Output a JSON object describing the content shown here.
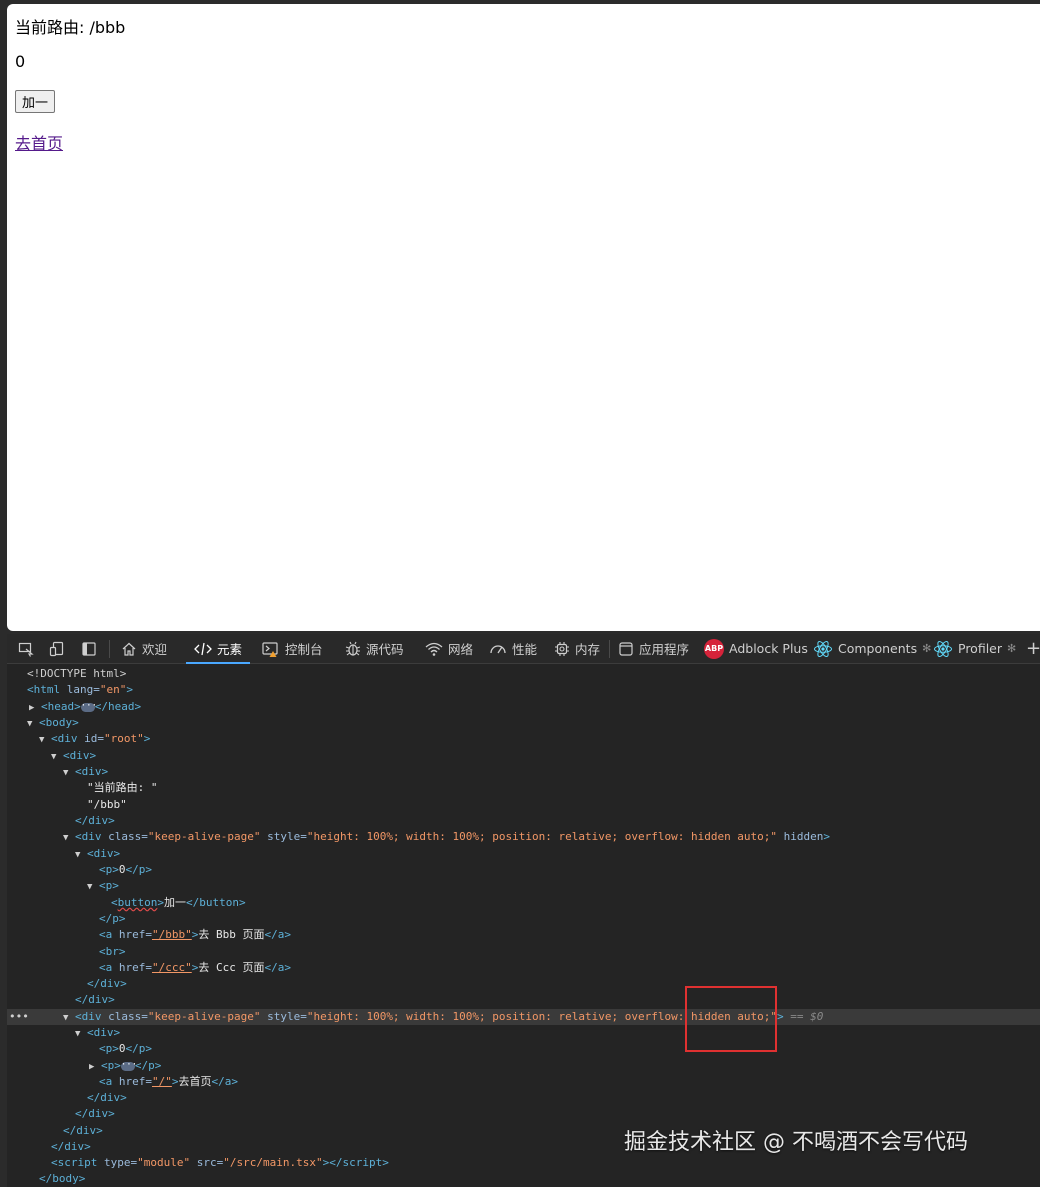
{
  "page": {
    "route_label": "当前路由: /bbb",
    "count": "0",
    "increment_button": "加一",
    "home_link": "去首页"
  },
  "devtools": {
    "tabs": [
      {
        "label": "欢迎",
        "icon": "home-icon"
      },
      {
        "label": "元素",
        "icon": "code-icon",
        "active": true
      },
      {
        "label": "控制台",
        "icon": "console-warning-icon"
      },
      {
        "label": "源代码",
        "icon": "bug-icon"
      },
      {
        "label": "网络",
        "icon": "wifi-icon"
      },
      {
        "label": "性能",
        "icon": "gauge-icon"
      },
      {
        "label": "内存",
        "icon": "chip-icon"
      },
      {
        "label": "应用程序",
        "icon": "app-icon"
      },
      {
        "label": "Adblock Plus",
        "icon": "abp-icon",
        "badge": "ABP"
      },
      {
        "label": "Components",
        "icon": "react-icon"
      },
      {
        "label": "Profiler",
        "icon": "react-icon"
      }
    ],
    "more_tabs": "+",
    "tree": {
      "doctype": "<!DOCTYPE html>",
      "tag_html": "html",
      "attr_lang": "lang",
      "val_lang": "\"en\"",
      "tag_head": "head",
      "tag_body": "body",
      "tag_div": "div",
      "attr_id": "id",
      "val_root": "\"root\"",
      "text_route_1": "\"当前路由: \"",
      "text_route_2": "\"/bbb\"",
      "attr_class": "class",
      "val_class": "\"keep-alive-page\"",
      "attr_style": "style",
      "val_style": "\"height: 100%; width: 100%; position: relative; overflow: hidden auto;\"",
      "attr_hidden": "hidden",
      "tag_p": "p",
      "text_zero": "0",
      "tag_button": "button",
      "text_increment": "加一",
      "tag_a": "a",
      "attr_href": "href",
      "val_href_bbb": "\"/bbb\"",
      "text_go_bbb": "去 Bbb 页面",
      "tag_br": "br",
      "val_href_ccc": "\"/ccc\"",
      "text_go_ccc": "去 Ccc 页面",
      "val_href_root": "\"/\"",
      "text_go_home": "去首页",
      "eq_marker": "== $0",
      "tag_script": "script",
      "attr_type": "type",
      "val_module": "\"module\"",
      "attr_src": "src",
      "val_src": "\"/src/main.tsx\""
    }
  },
  "watermark": "掘金技术社区 @ 不喝酒不会写代码",
  "colors": {
    "tag": "#5db0d7",
    "attr_name": "#9bbbdc",
    "attr_value": "#f29766",
    "highlight": "#e03131",
    "active_tab": "#4aa8ff"
  }
}
